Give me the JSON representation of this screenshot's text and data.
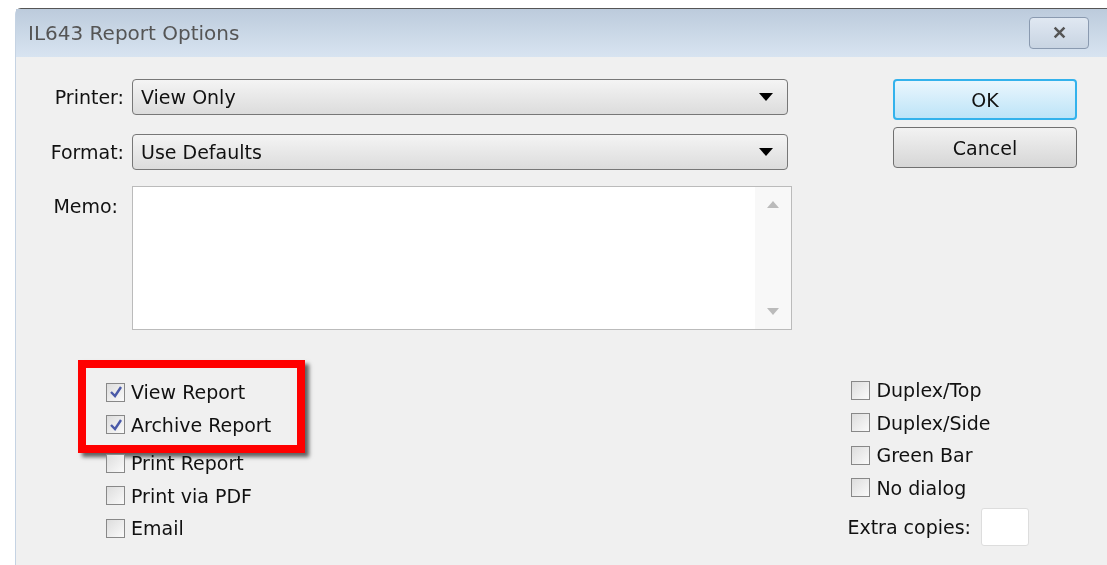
{
  "window": {
    "title": "IL643 Report Options",
    "close_glyph": "✕"
  },
  "fields": [
    {
      "kind": "dropdown",
      "label": "Printer:",
      "value": "View Only"
    },
    {
      "kind": "dropdown",
      "label": "Format:",
      "value": "Use Defaults"
    },
    {
      "kind": "memo",
      "label": "Memo:"
    }
  ],
  "buttons": [
    {
      "label": "OK",
      "default": true
    },
    {
      "label": "Cancel",
      "default": false
    }
  ],
  "left_checks": [
    {
      "label": "View Report",
      "checked": true,
      "highlighted": true
    },
    {
      "label": "Archive Report",
      "checked": true,
      "highlighted": true
    },
    {
      "label": "Print Report",
      "checked": false,
      "highlighted": false
    },
    {
      "label": "Print via PDF",
      "checked": false,
      "highlighted": false
    },
    {
      "label": "Email",
      "checked": false,
      "highlighted": false
    }
  ],
  "right_checks": [
    {
      "label": "Duplex/Top",
      "checked": false
    },
    {
      "label": "Duplex/Side",
      "checked": false
    },
    {
      "label": "Green Bar",
      "checked": false
    },
    {
      "label": "No dialog",
      "checked": false
    }
  ],
  "extra_copies": {
    "label": "Extra copies:"
  }
}
